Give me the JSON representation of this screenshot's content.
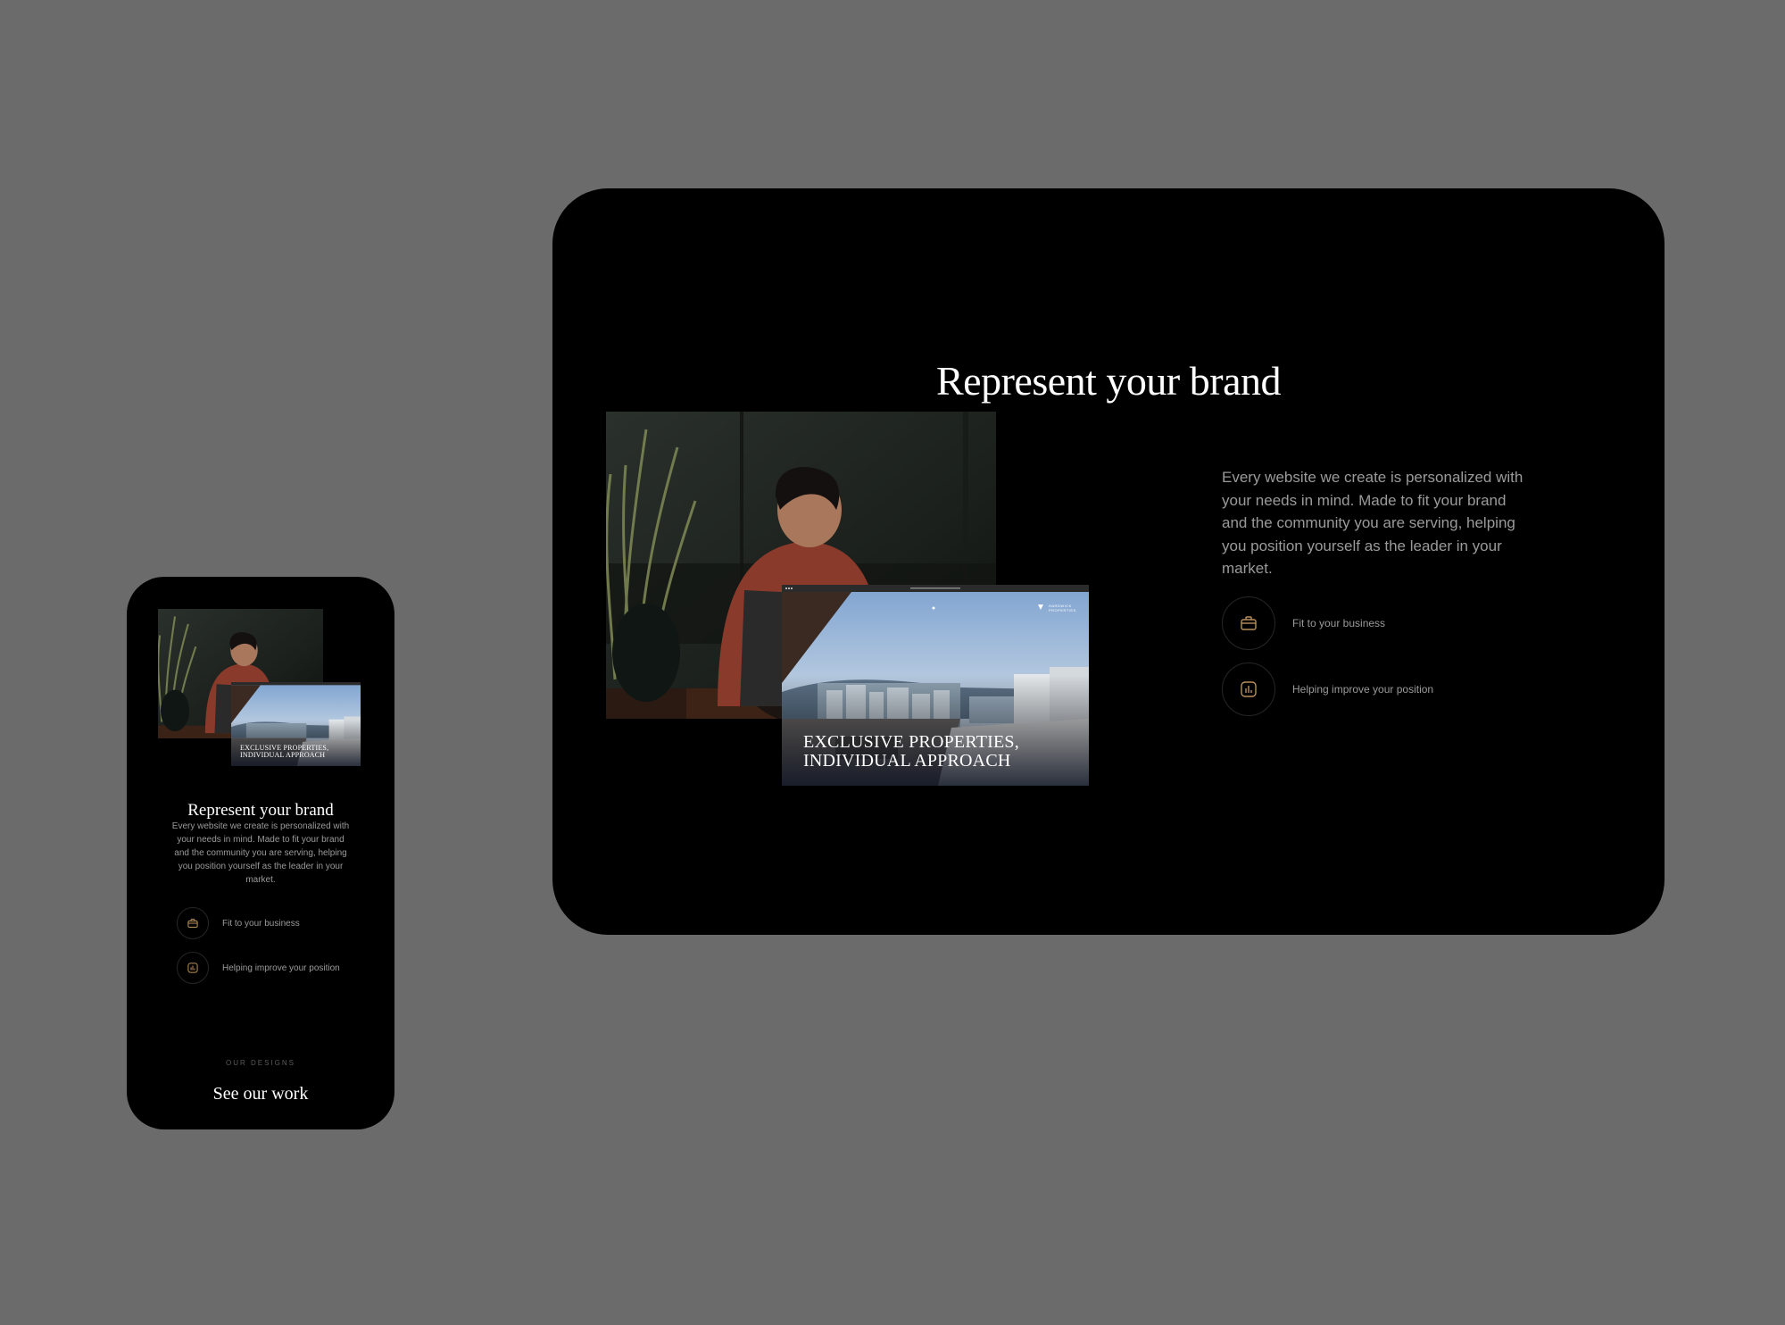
{
  "colors": {
    "canvas": "#6b6b6b",
    "card": "#000000",
    "body_text": "#9a9a9a",
    "accent_gold": "#b8905a",
    "heading": "#ffffff"
  },
  "desktop": {
    "title": "Represent your brand",
    "description": "Every website we create is personalized with your needs in mind. Made to fit your brand and the community you are serving, helping you position yourself as the leader in your market.",
    "features": [
      {
        "icon": "briefcase-icon",
        "label": "Fit to your business"
      },
      {
        "icon": "chart-icon",
        "label": "Helping improve your position"
      }
    ],
    "site_mockup": {
      "headline_line1": "EXCLUSIVE PROPERTIES,",
      "headline_line2": "INDIVIDUAL APPROACH"
    }
  },
  "mobile": {
    "title": "Represent your brand",
    "description": "Every website we create is personalized with your needs in mind. Made to fit your brand and the community you are serving, helping you position yourself as the leader in your market.",
    "features": [
      {
        "icon": "briefcase-icon",
        "label": "Fit to your business"
      },
      {
        "icon": "chart-icon",
        "label": "Helping improve your position"
      }
    ],
    "site_mockup": {
      "headline_line1": "EXCLUSIVE PROPERTIES,",
      "headline_line2": "INDIVIDUAL APPROACH"
    },
    "eyebrow": "OUR DESIGNS",
    "cta": "See our work"
  }
}
